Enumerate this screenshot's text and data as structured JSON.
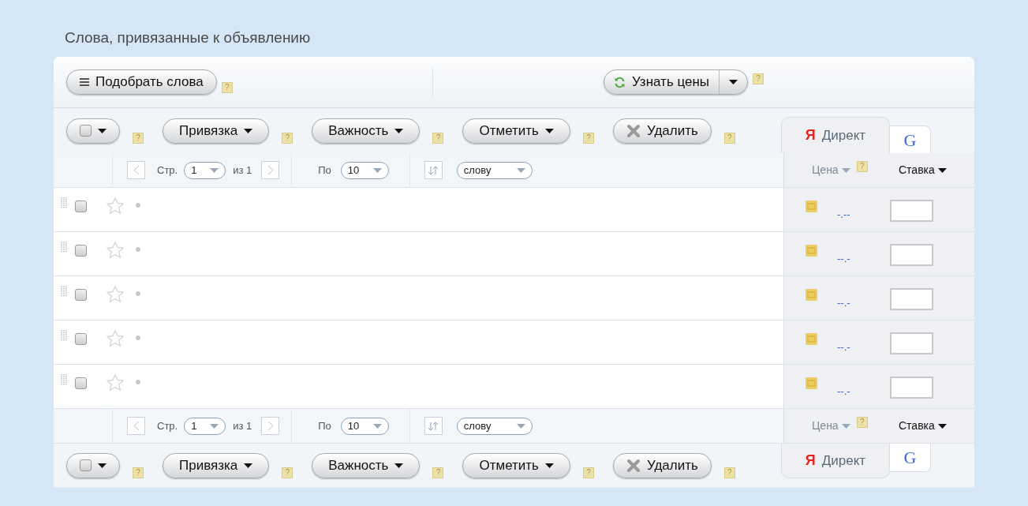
{
  "title": "Слова, привязанные к объявлению",
  "top_toolbar": {
    "pick_button": {
      "label": "Подобрать слова",
      "help": "?"
    },
    "prices_button": {
      "label": "Узнать цены",
      "help": "?"
    }
  },
  "actions_top": {
    "buttons": [
      {
        "kind": "checkbox",
        "checked": false,
        "help": "?"
      },
      {
        "kind": "menu",
        "label": "Привязка",
        "help": "?"
      },
      {
        "kind": "menu",
        "label": "Важность",
        "help": "?"
      },
      {
        "kind": "menu",
        "label": "Отметить",
        "help": "?"
      },
      {
        "kind": "delete",
        "label": "Удалить",
        "help": "?"
      }
    ],
    "tabs": [
      {
        "kind": "yandex",
        "mark": "Я",
        "label": "Директ",
        "selected": true
      },
      {
        "kind": "google",
        "mark": "G",
        "selected": false
      }
    ]
  },
  "pager_top": {
    "page_label": "Стр.",
    "page": "1",
    "of": "из 1",
    "per_label": "По",
    "per_page": "10",
    "sort": "слову"
  },
  "columns_top": [
    {
      "kind": "muted",
      "label": "Цена",
      "help": "?"
    },
    {
      "kind": "menu",
      "label": "Ставка"
    }
  ],
  "rows": [
    {
      "checked": false,
      "starred": false,
      "price": "-.--"
    },
    {
      "checked": false,
      "starred": false,
      "price": "--.-"
    },
    {
      "checked": false,
      "starred": false,
      "price": "--.-"
    },
    {
      "checked": false,
      "starred": false,
      "price": "--.-"
    },
    {
      "checked": false,
      "starred": false,
      "price": "--.-"
    }
  ],
  "pager_bottom": {
    "page_label": "Стр.",
    "page": "1",
    "of": "из 1",
    "per_label": "По",
    "per_page": "10",
    "sort": "слову"
  },
  "columns_bottom": [
    {
      "kind": "muted",
      "label": "Цена",
      "help": "?"
    },
    {
      "kind": "menu",
      "label": "Ставка"
    }
  ],
  "actions_bottom": {
    "buttons": [
      {
        "kind": "checkbox",
        "checked": false,
        "help": "?"
      },
      {
        "kind": "menu",
        "label": "Привязка",
        "help": "?"
      },
      {
        "kind": "menu",
        "label": "Важность",
        "help": "?"
      },
      {
        "kind": "menu",
        "label": "Отметить",
        "help": "?"
      },
      {
        "kind": "delete",
        "label": "Удалить",
        "help": "?"
      }
    ],
    "tabs": [
      {
        "kind": "yandex",
        "mark": "Я",
        "label": "Директ",
        "selected": true
      },
      {
        "kind": "google",
        "mark": "G",
        "selected": false
      }
    ]
  }
}
